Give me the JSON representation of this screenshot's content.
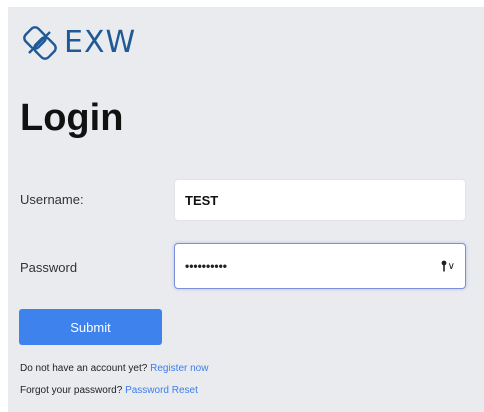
{
  "brand": {
    "name": "EXW",
    "logo_icon": "exw-logo-icon",
    "color": "#1f5a96"
  },
  "page": {
    "title": "Login"
  },
  "form": {
    "username_label": "Username:",
    "username_value": "TEST",
    "password_label": "Password",
    "password_mask": "••••••••••",
    "password_toggle_icon": "key-icon",
    "submit_label": "Submit"
  },
  "footer": {
    "register_prompt": "Do not have an account yet?",
    "register_link": "Register now",
    "reset_prompt": "Forgot your password?",
    "reset_link": "Password Reset"
  },
  "colors": {
    "background": "#e9ebef",
    "accent": "#3e82ee",
    "link": "#3e7ee8",
    "focus_border": "#7d8fdc"
  }
}
